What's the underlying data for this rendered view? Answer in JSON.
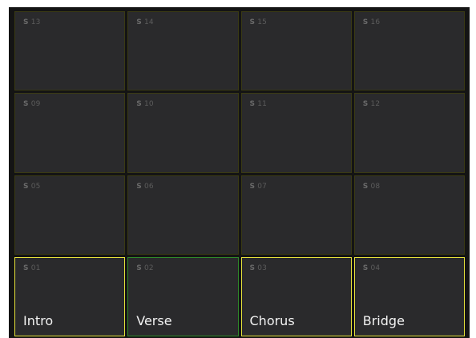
{
  "pads": [
    {
      "prefix": "S",
      "num": "13",
      "label": "",
      "state": "idle"
    },
    {
      "prefix": "S",
      "num": "14",
      "label": "",
      "state": "idle"
    },
    {
      "prefix": "S",
      "num": "15",
      "label": "",
      "state": "idle"
    },
    {
      "prefix": "S",
      "num": "16",
      "label": "",
      "state": "idle"
    },
    {
      "prefix": "S",
      "num": "09",
      "label": "",
      "state": "idle"
    },
    {
      "prefix": "S",
      "num": "10",
      "label": "",
      "state": "idle"
    },
    {
      "prefix": "S",
      "num": "11",
      "label": "",
      "state": "idle"
    },
    {
      "prefix": "S",
      "num": "12",
      "label": "",
      "state": "idle"
    },
    {
      "prefix": "S",
      "num": "05",
      "label": "",
      "state": "idle"
    },
    {
      "prefix": "S",
      "num": "06",
      "label": "",
      "state": "idle"
    },
    {
      "prefix": "S",
      "num": "07",
      "label": "",
      "state": "idle"
    },
    {
      "prefix": "S",
      "num": "08",
      "label": "",
      "state": "idle"
    },
    {
      "prefix": "S",
      "num": "01",
      "label": "Intro",
      "state": "yellow"
    },
    {
      "prefix": "S",
      "num": "02",
      "label": "Verse",
      "state": "green"
    },
    {
      "prefix": "S",
      "num": "03",
      "label": "Chorus",
      "state": "yellow"
    },
    {
      "prefix": "S",
      "num": "04",
      "label": "Bridge",
      "state": "yellow"
    }
  ],
  "colors": {
    "background": "#141414",
    "pad": "#2a2a2c",
    "pad_border_idle": "#3a3a14",
    "pad_border_yellow": "#e6e23a",
    "pad_border_green": "#2f8a2a",
    "label_text": "#f2f2f2",
    "id_text": "#5c5c5c"
  }
}
